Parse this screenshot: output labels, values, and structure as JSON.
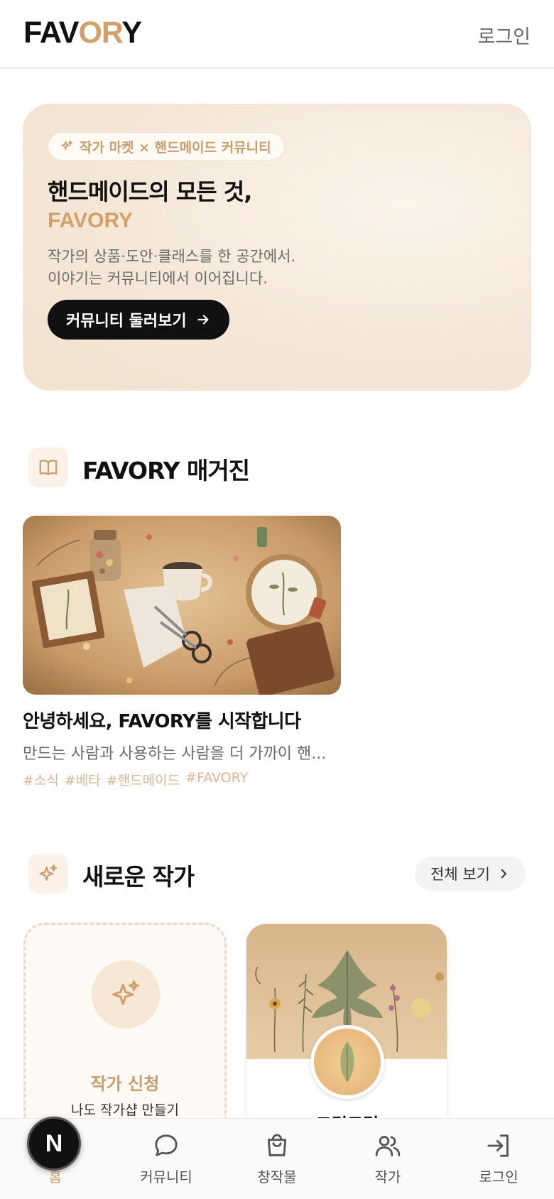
{
  "header": {
    "logo_prefix": "FAV",
    "logo_accent": "OR",
    "logo_suffix": "Y",
    "login": "로그인"
  },
  "hero": {
    "pill": "작가 마켓 × 핸드메이드 커뮤니티",
    "title": "핸드메이드의 모든 것,",
    "brand": "FAVORY",
    "desc_line1": "작가의 상품·도안·클래스를 한 공간에서.",
    "desc_line2": "이야기는 커뮤니티에서 이어집니다.",
    "button": "커뮤니티 둘러보기"
  },
  "magazine": {
    "section_title": "FAVORY 매거진",
    "card": {
      "title": "안녕하세요, FAVORY를 시작합니다",
      "summary": "만드는 사람과 사용하는 사람을 더 가까이 핸...",
      "tags": [
        "#소식",
        "#베타",
        "#핸드메이드",
        "#FAVORY"
      ]
    }
  },
  "new_artists": {
    "section_title": "새로운 작가",
    "see_all": "전체 보기",
    "apply_card": {
      "title": "작가 신청",
      "subtitle": "나도 작가샵 만들기"
    },
    "artists": [
      {
        "name": "그린드림"
      }
    ]
  },
  "bottom_nav": {
    "items": [
      {
        "label": "홈",
        "icon": "home-icon",
        "active": true
      },
      {
        "label": "커뮤니티",
        "icon": "chat-bubble-icon"
      },
      {
        "label": "창작물",
        "icon": "shopping-bag-icon"
      },
      {
        "label": "작가",
        "icon": "users-icon"
      },
      {
        "label": "로그인",
        "icon": "login-icon"
      }
    ],
    "badge_letter": "N"
  },
  "colors": {
    "accent": "#d4a06a",
    "hero_bg": "#f5e7d7",
    "dark": "#111111"
  }
}
